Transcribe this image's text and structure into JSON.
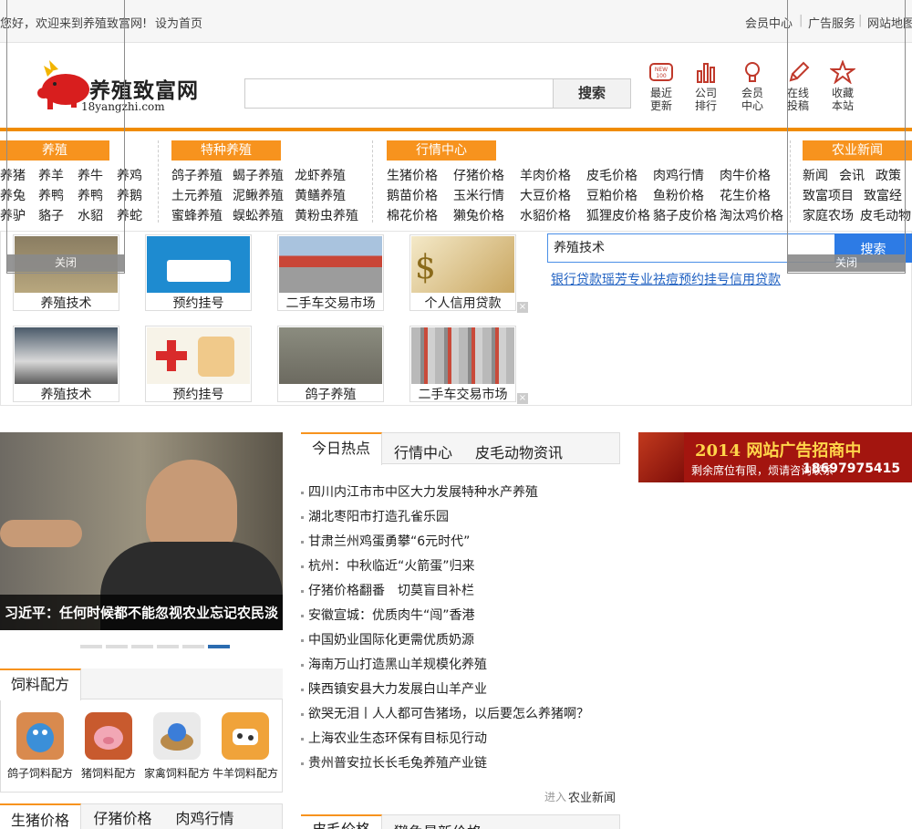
{
  "topbar": {
    "welcome": "您好，欢迎来到养殖致富网!",
    "set_home": "设为首页",
    "member": "会员中心",
    "sep": "|",
    "ads": "广告服务",
    "sitemap": "网站地图"
  },
  "logo": {
    "name": "养殖致富网",
    "domain": "18yangzhi.com"
  },
  "search": {
    "button": "搜索"
  },
  "toolbar": [
    {
      "label1": "最近",
      "label2": "更新",
      "icon": "new-100-icon"
    },
    {
      "label1": "公司",
      "label2": "排行",
      "icon": "bar-chart-icon"
    },
    {
      "label1": "会员",
      "label2": "中心",
      "icon": "lightbulb-icon"
    },
    {
      "label1": "在线",
      "label2": "投稿",
      "icon": "pencil-icon"
    },
    {
      "label1": "收藏",
      "label2": "本站",
      "icon": "star-icon"
    }
  ],
  "categories": {
    "breeding": {
      "title": "养殖",
      "rows": [
        [
          "养猪",
          "养羊",
          "养牛",
          "养鸡"
        ],
        [
          "养兔",
          "养鸭",
          "养鸭",
          "养鹅"
        ],
        [
          "养驴",
          "貉子",
          "水貂",
          "养蛇"
        ]
      ]
    },
    "special": {
      "title": "特种养殖",
      "rows": [
        [
          "鸽子养殖",
          "蝎子养殖",
          "龙虾养殖"
        ],
        [
          "土元养殖",
          "泥鳅养殖",
          "黄鳝养殖"
        ],
        [
          "蜜蜂养殖",
          "蜈蚣养殖",
          "黄粉虫养殖"
        ]
      ]
    },
    "market": {
      "title": "行情中心",
      "rows": [
        [
          "生猪价格",
          "仔猪价格",
          "羊肉价格",
          "皮毛价格",
          "肉鸡行情",
          "肉牛价格"
        ],
        [
          "鹅苗价格",
          "玉米行情",
          "大豆价格",
          "豆粕价格",
          "鱼粉价格",
          "花生价格"
        ],
        [
          "棉花价格",
          "獭兔价格",
          "水貂价格",
          "狐狸皮价格",
          "貉子皮价格",
          "淘汰鸡价格"
        ]
      ]
    },
    "agri": {
      "title": "农业新闻",
      "rows": [
        [
          "新闻",
          "会讯",
          "政策"
        ],
        [
          "致富项目",
          "致富经"
        ],
        [
          "家庭农场",
          "皮毛动物"
        ]
      ]
    }
  },
  "ad_block": {
    "row1": [
      "养殖技术",
      "预约挂号",
      "二手车交易市场",
      "个人信用贷款"
    ],
    "row2": [
      "养殖技术",
      "预约挂号",
      "鸽子养殖",
      "二手车交易市场"
    ],
    "search_value": "养殖技术",
    "search_button": "搜索",
    "link": "银行贷款瑶芳专业祛痘预约挂号信用贷款",
    "close": "关闭",
    "x": "×"
  },
  "banner": {
    "caption": "习近平：任何时候都不能忽视农业忘记农民淡"
  },
  "feed": {
    "tab": "饲料配方",
    "items": [
      "鸽子饲料配方",
      "猪饲料配方",
      "家禽饲料配方",
      "牛羊饲料配方"
    ]
  },
  "price_tabs": [
    "生猪价格",
    "仔猪价格",
    "肉鸡行情"
  ],
  "news": {
    "tabs": [
      "今日热点",
      "行情中心",
      "皮毛动物资讯"
    ],
    "items": [
      "四川内江市市中区大力发展特种水产养殖",
      "湖北枣阳市打造孔雀乐园",
      "甘肃兰州鸡蛋勇攀“6元时代”",
      "杭州：中秋临近“火箭蛋”归来",
      "仔猪价格翻番　切莫盲目补栏",
      "安徽宣城：优质肉牛“闯”香港",
      "中国奶业国际化更需优质奶源",
      "海南万山打造黑山羊规模化养殖",
      "陕西镇安县大力发展白山羊产业",
      "欲哭无泪丨人人都可告猪场，以后要怎么养猪啊？",
      "上海农业生态环保有目标见行动",
      "贵州普安拉长长毛兔养殖产业链"
    ],
    "more_prefix": "进入",
    "more_link": "农业新闻",
    "tabs2": [
      "皮毛价格",
      "獭兔最新价格"
    ]
  },
  "right_ad": {
    "title": "2014 网站广告招商中",
    "sub": "剩余席位有限，烦请咨询联系",
    "phone": "18697975415"
  },
  "colors": {
    "accent": "#f7931e",
    "link_blue": "#2162c2",
    "ad_red": "#a3150f"
  }
}
